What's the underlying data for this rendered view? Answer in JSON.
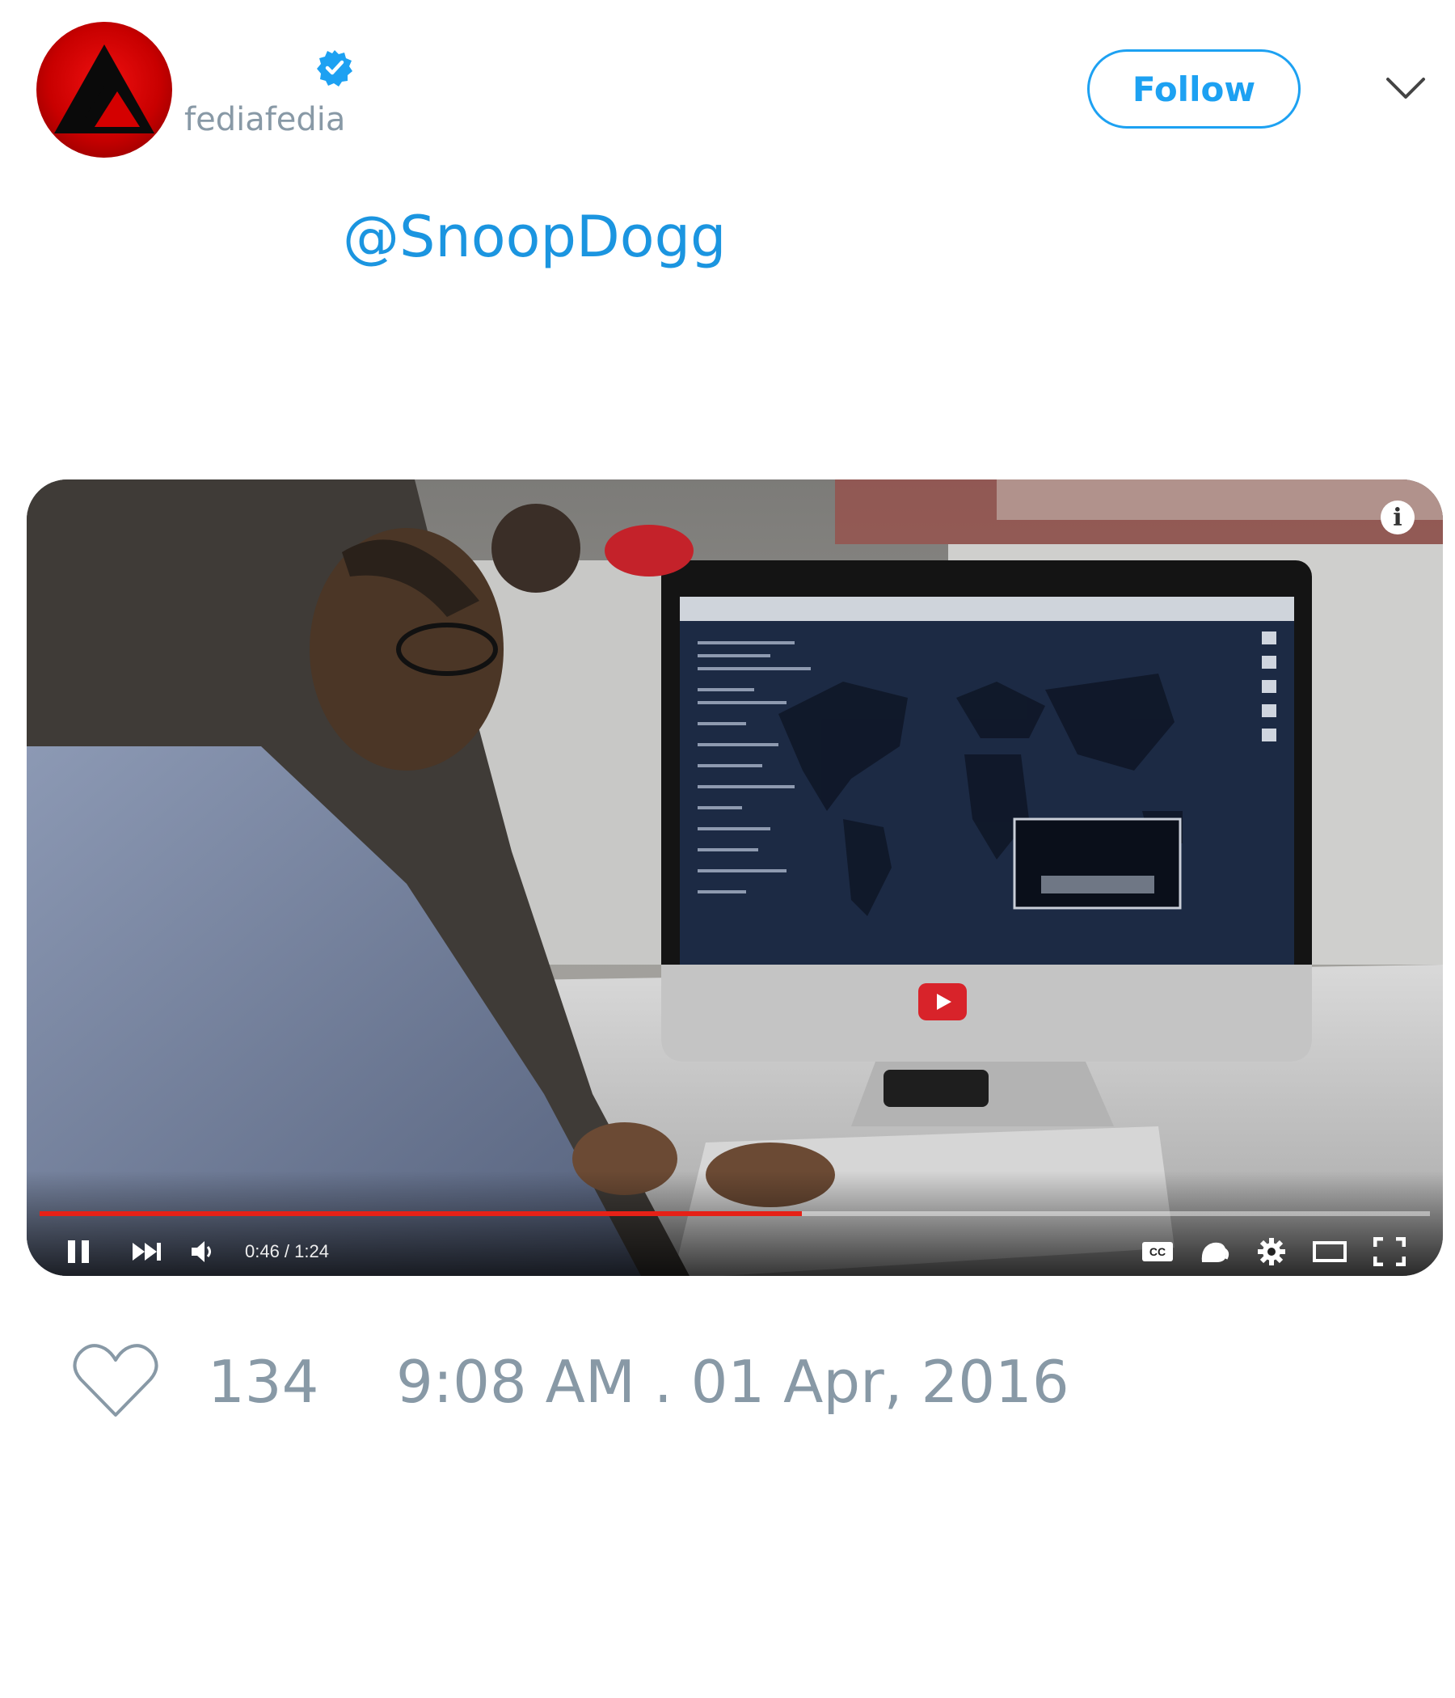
{
  "header": {
    "handle": "fediafedia",
    "follow_label": "Follow"
  },
  "tweet": {
    "mention": "@SnoopDogg"
  },
  "video": {
    "current_time": "0:46",
    "duration": "1:24",
    "time_label": "0:46 / 1:24",
    "progress_fraction": 0.548,
    "accent_color": "#e62117",
    "controls": [
      "pause-icon",
      "next-icon",
      "volume-icon",
      "cc-icon",
      "annotations-icon",
      "settings-icon",
      "theater-icon",
      "fullscreen-icon"
    ]
  },
  "footer": {
    "likes": "134",
    "timestamp": "9:08 AM . 01 Apr, 2016"
  },
  "colors": {
    "brand_blue": "#1da1f2",
    "meta_gray": "#8899a6",
    "link_blue": "#1b95e0"
  }
}
